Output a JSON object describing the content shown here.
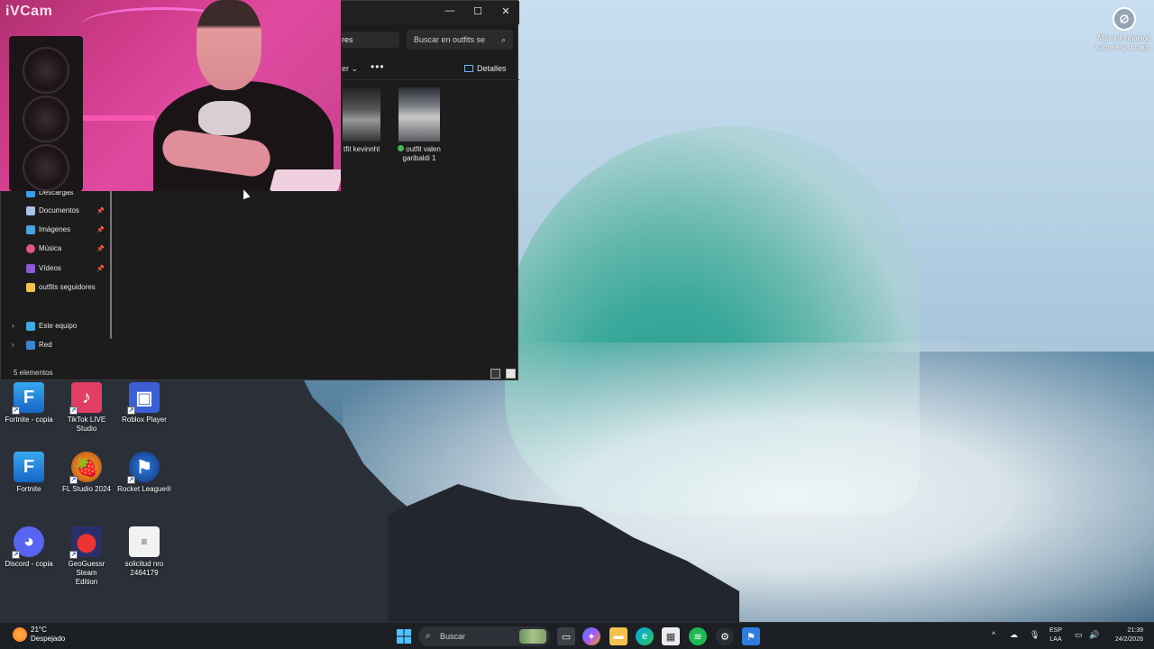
{
  "wallpaper": {
    "info_label_line1": "Más información",
    "info_label_line2": "sobre esta imag..."
  },
  "webcam": {
    "label": "iVCam"
  },
  "explorer": {
    "tab_label": "res",
    "search_placeholder": "Buscar en outfits se",
    "view_label": "er",
    "more_label": "•••",
    "details_label": "Detalles",
    "files": [
      {
        "name_line1": "tfit kevinnhl",
        "name_line2": ""
      },
      {
        "name_line1": "outfit valen",
        "name_line2": "garibaldi 1"
      }
    ],
    "nav": {
      "downloads": "Descargas",
      "documents": "Documentos",
      "images": "Imágenes",
      "music": "Música",
      "videos": "Vídeos",
      "folder": "outfits seguidores",
      "this_pc": "Este equipo",
      "network": "Red"
    },
    "status": "5 elementos"
  },
  "desktop_icons": [
    {
      "label_line1": "Fortnite - copia",
      "label_line2": ""
    },
    {
      "label_line1": "TikTok LIVE",
      "label_line2": "Studio"
    },
    {
      "label_line1": "Roblox Player",
      "label_line2": ""
    },
    {
      "label_line1": "Fortnite",
      "label_line2": ""
    },
    {
      "label_line1": "FL Studio 2024",
      "label_line2": ""
    },
    {
      "label_line1": "Rocket League®",
      "label_line2": ""
    },
    {
      "label_line1": "Discord - copia",
      "label_line2": ""
    },
    {
      "label_line1": "GeoGuessr Steam",
      "label_line2": "Edition"
    },
    {
      "label_line1": "solicitud nro",
      "label_line2": "2464179"
    }
  ],
  "taskbar": {
    "weather_temp": "21°C",
    "weather_desc": "Despejado",
    "search_label": "Buscar",
    "lang_line1": "ESP",
    "lang_line2": "LAA",
    "time": "21:39",
    "date": "24/2/2026"
  },
  "colors": {
    "explorer_bg": "#1c1c1c",
    "taskbar_bg": "#1c1f24",
    "accent": "#0078d4"
  }
}
